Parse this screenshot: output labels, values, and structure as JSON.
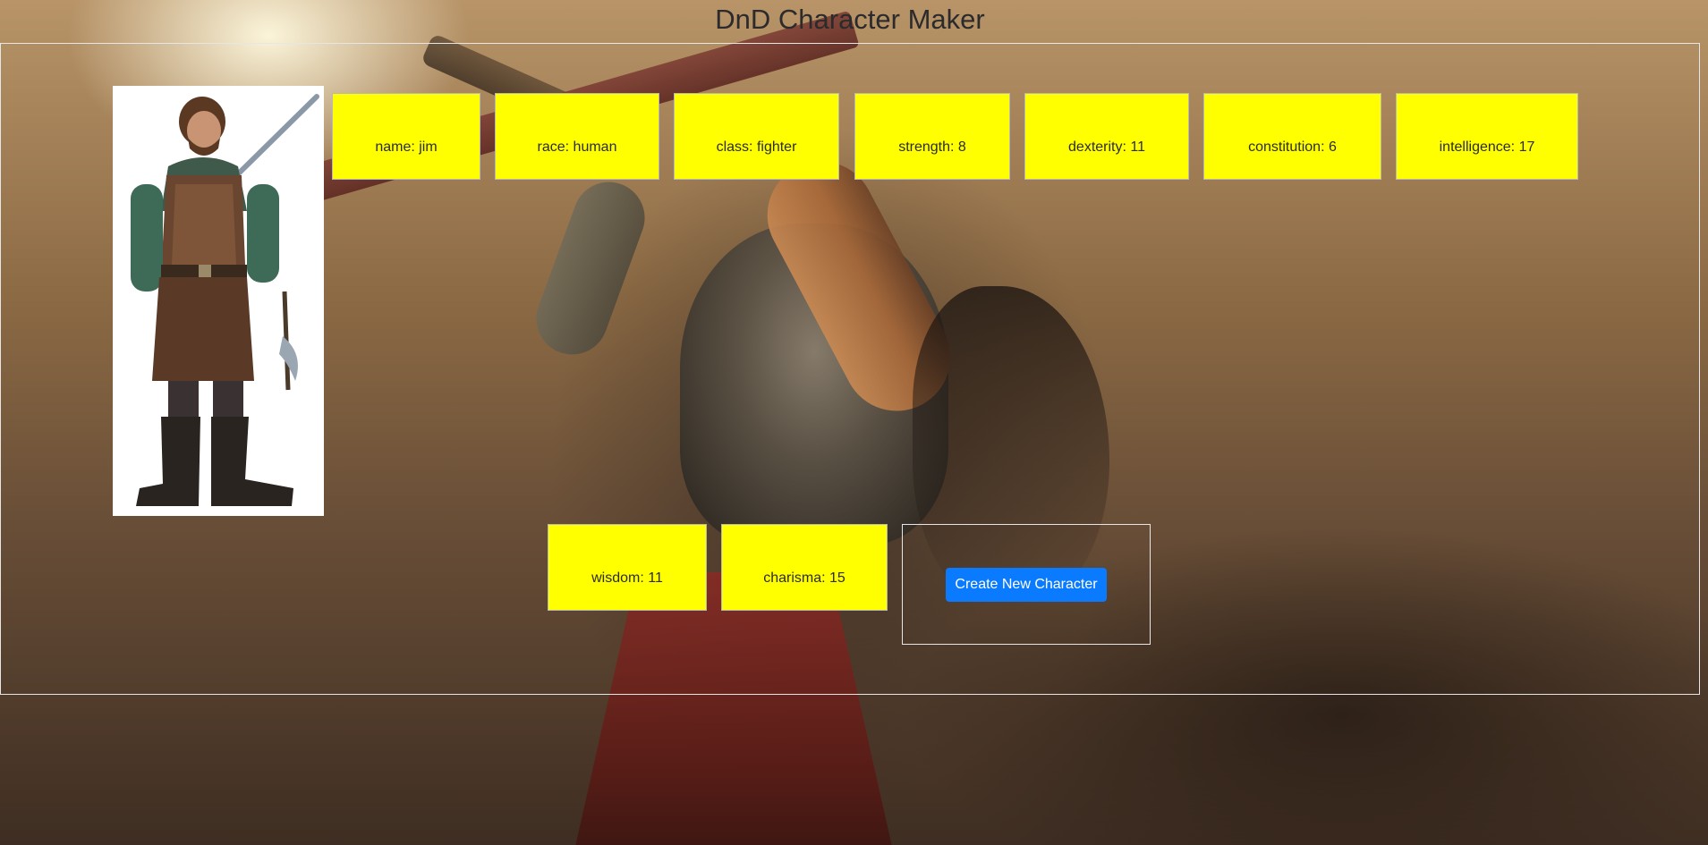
{
  "page": {
    "title": "DnD Character Maker"
  },
  "character": {
    "stats": [
      {
        "label": "name: jim"
      },
      {
        "label": "race: human"
      },
      {
        "label": "class: fighter"
      },
      {
        "label": "strength: 8"
      },
      {
        "label": "dexterity: 11"
      },
      {
        "label": "constitution: 6"
      },
      {
        "label": "intelligence: 17"
      },
      {
        "label": "wisdom: 11"
      },
      {
        "label": "charisma: 15"
      }
    ]
  },
  "actions": {
    "create_label": "Create New Character"
  },
  "colors": {
    "stat_background": "#ffff00",
    "button_primary": "#0a7bff"
  }
}
